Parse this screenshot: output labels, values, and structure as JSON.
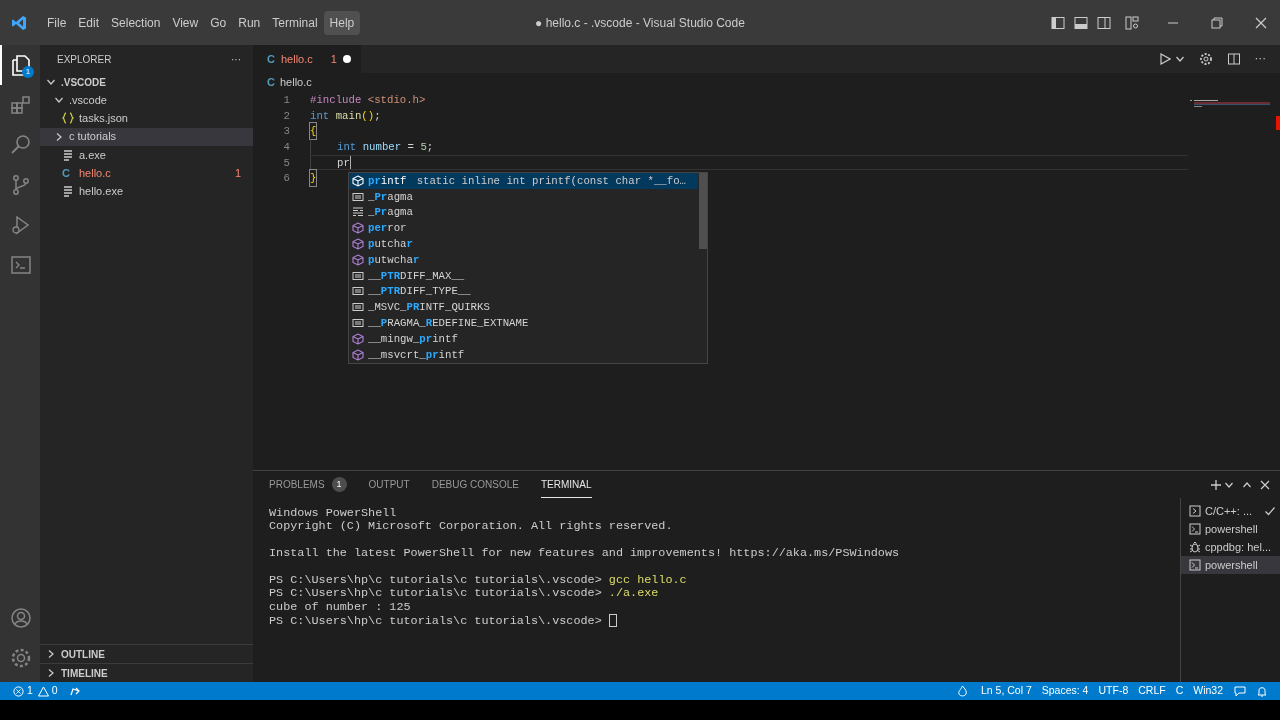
{
  "title_bar": {
    "menu": [
      {
        "label": "File",
        "hovered": false
      },
      {
        "label": "Edit",
        "hovered": false
      },
      {
        "label": "Selection",
        "hovered": false
      },
      {
        "label": "View",
        "hovered": false
      },
      {
        "label": "Go",
        "hovered": false
      },
      {
        "label": "Run",
        "hovered": false
      },
      {
        "label": "Terminal",
        "hovered": false
      },
      {
        "label": "Help",
        "hovered": true
      }
    ],
    "title": "● hello.c - .vscode - Visual Studio Code"
  },
  "activity_bar": {
    "items": [
      {
        "kind": "explorer",
        "selected": true,
        "badge": "1"
      },
      {
        "kind": "extensions",
        "selected": false
      },
      {
        "kind": "search",
        "selected": false
      },
      {
        "kind": "source-control",
        "selected": false
      },
      {
        "kind": "run-debug",
        "selected": false
      },
      {
        "kind": "remote",
        "selected": false
      }
    ],
    "bottom": [
      {
        "kind": "account"
      },
      {
        "kind": "settings"
      }
    ]
  },
  "sidebar": {
    "title": "EXPLORER",
    "more": "···",
    "tree": [
      {
        "label": ".VSCODE",
        "kind": "root",
        "expanded": true,
        "children": [
          {
            "label": ".vscode",
            "kind": "folder",
            "expanded": true,
            "selected": false,
            "children": [
              {
                "label": "tasks.json",
                "kind": "json",
                "selected": false
              }
            ]
          },
          {
            "label": "c tutorials",
            "kind": "folder",
            "expanded": false,
            "selected": true
          },
          {
            "label": "a.exe",
            "kind": "file",
            "selected": false
          },
          {
            "label": "hello.c",
            "kind": "c",
            "icon": "C",
            "selected": false,
            "error": true,
            "badge": "1"
          },
          {
            "label": "hello.exe",
            "kind": "file",
            "selected": false
          }
        ]
      }
    ],
    "sections": [
      {
        "label": "OUTLINE",
        "expanded": false
      },
      {
        "label": "TIMELINE",
        "expanded": false
      }
    ]
  },
  "editor": {
    "tabs": [
      {
        "label": "hello.c",
        "icon": "C",
        "count": "1",
        "dirty": true,
        "selected": true
      }
    ],
    "more_actions": "···",
    "breadcrumb": {
      "icon": "C",
      "label": "hello.c"
    },
    "lines": [
      {
        "number": "1",
        "indented": false,
        "current": false,
        "tokens": [
          {
            "text": "#include",
            "kind": "directive"
          },
          {
            "text": " <stdio.h>",
            "kind": "string"
          }
        ]
      },
      {
        "number": "2",
        "indented": false,
        "current": false,
        "tokens": [
          {
            "text": "int",
            "kind": "keyword"
          },
          {
            "text": " main",
            "kind": "function"
          },
          {
            "text": "()",
            "kind": "bracket"
          },
          {
            "text": ";",
            "kind": "punct"
          }
        ]
      },
      {
        "number": "3",
        "indented": false,
        "current": false,
        "tokens": [
          {
            "text": "{",
            "kind": "bracket-match"
          }
        ]
      },
      {
        "number": "4",
        "indented": true,
        "current": false,
        "tokens": [
          {
            "text": "int",
            "kind": "keyword"
          },
          {
            "text": " number",
            "kind": "variable"
          },
          {
            "text": " = ",
            "kind": "punct"
          },
          {
            "text": "5",
            "kind": "number"
          },
          {
            "text": ";",
            "kind": "punct"
          }
        ]
      },
      {
        "number": "5",
        "indented": true,
        "current": true,
        "cursor": true,
        "tokens": [
          {
            "text": "pr",
            "kind": "text"
          }
        ]
      },
      {
        "number": "6",
        "indented": false,
        "current": false,
        "tokens": [
          {
            "text": "}",
            "kind": "bracket-match"
          }
        ]
      }
    ],
    "suggestions": [
      {
        "kind": "method",
        "selected": true,
        "label": "**pr**intf",
        "detail": "static inline int printf(const char *__fo…"
      },
      {
        "kind": "constant",
        "selected": false,
        "label": "_**Pr**agma"
      },
      {
        "kind": "snippet",
        "selected": false,
        "label": "_**Pr**agma"
      },
      {
        "kind": "method",
        "selected": false,
        "label": "**per**ror"
      },
      {
        "kind": "method",
        "selected": false,
        "label": "**p**utcha**r**"
      },
      {
        "kind": "method",
        "selected": false,
        "label": "**p**utwcha**r**"
      },
      {
        "kind": "constant",
        "selected": false,
        "label": "__**PTR**DIFF_MAX__"
      },
      {
        "kind": "constant",
        "selected": false,
        "label": "__**PTR**DIFF_TYPE__"
      },
      {
        "kind": "constant",
        "selected": false,
        "label": "_MSVC_**PR**INTF_QUIRKS"
      },
      {
        "kind": "constant",
        "selected": false,
        "label": "__**P**RAGMA_**R**EDEFINE_EXTNAME"
      },
      {
        "kind": "method",
        "selected": false,
        "label": "__mingw_**pr**intf"
      },
      {
        "kind": "method",
        "selected": false,
        "label": "__msvcrt_**pr**intf"
      }
    ]
  },
  "panel": {
    "tabs": [
      {
        "label": "PROBLEMS",
        "badge": "1",
        "selected": false
      },
      {
        "label": "OUTPUT",
        "selected": false
      },
      {
        "label": "DEBUG CONSOLE",
        "selected": false
      },
      {
        "label": "TERMINAL",
        "selected": true
      }
    ],
    "terminal_lines": [
      {
        "text": "Windows PowerShell",
        "gap_before": false
      },
      {
        "text": "Copyright (C) Microsoft Corporation. All rights reserved.",
        "gap_before": false
      },
      {
        "text": "Install the latest PowerShell for new features and improvements! https://aka.ms/PSWindows",
        "gap_before": true
      },
      {
        "prompt": "PS C:\\Users\\hp\\c tutorials\\c tutorials\\.vscode>",
        "command": "gcc hello.c",
        "gap_before": true
      },
      {
        "prompt": "PS C:\\Users\\hp\\c tutorials\\c tutorials\\.vscode>",
        "command": "./a.exe",
        "gap_before": false
      },
      {
        "text": "cube of number : 125",
        "gap_before": false
      },
      {
        "prompt": "PS C:\\Users\\hp\\c tutorials\\c tutorials\\.vscode>",
        "cursor": true,
        "gap_before": false
      }
    ],
    "terminals": [
      {
        "kind": "task",
        "label": "C/C++: ...",
        "done": true,
        "selected": false
      },
      {
        "kind": "shell",
        "label": "powershell",
        "done": false,
        "selected": false
      },
      {
        "kind": "debug",
        "label": "cppdbg: hel...",
        "done": false,
        "selected": false
      },
      {
        "kind": "shell",
        "label": "powershell",
        "done": false,
        "selected": true
      }
    ]
  },
  "status_bar": {
    "errors": "1",
    "warnings": "0",
    "right": [
      "Ln 5, Col 7",
      "Spaces: 4",
      "UTF-8",
      "CRLF",
      "C",
      "Win32"
    ]
  }
}
